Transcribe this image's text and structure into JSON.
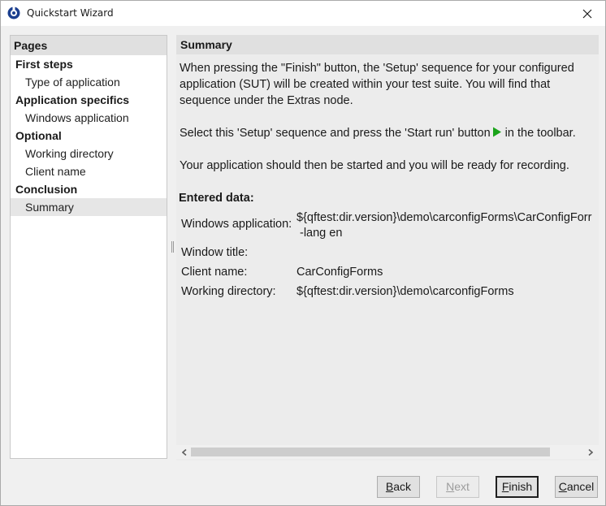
{
  "window": {
    "title": "Quickstart Wizard",
    "icon": "qftest-logo-icon",
    "close_icon": "close-icon"
  },
  "pages": {
    "header": "Pages",
    "items": [
      {
        "label": "First steps",
        "kind": "group",
        "selected": false
      },
      {
        "label": "Type of application",
        "kind": "sub",
        "selected": false
      },
      {
        "label": "Application specifics",
        "kind": "group",
        "selected": false
      },
      {
        "label": "Windows application",
        "kind": "sub",
        "selected": false
      },
      {
        "label": "Optional",
        "kind": "group",
        "selected": false
      },
      {
        "label": "Working directory",
        "kind": "sub",
        "selected": false
      },
      {
        "label": "Client name",
        "kind": "sub",
        "selected": false
      },
      {
        "label": "Conclusion",
        "kind": "group",
        "selected": false
      },
      {
        "label": "Summary",
        "kind": "sub",
        "selected": true
      }
    ]
  },
  "summary": {
    "header": "Summary",
    "paragraph1": [
      "When pressing the \"Finish\" button, the 'Setup' sequence for your configured",
      "application (SUT) will be created within your test suite. You will find that",
      "sequence under the Extras node."
    ],
    "paragraph2_before": "Select this 'Setup' sequence and press the 'Start run' button",
    "paragraph2_icon": "play-icon",
    "paragraph2_after": "in the toolbar.",
    "paragraph3": "Your application should then be started and you will be ready for recording.",
    "entered_title": "Entered data:",
    "entered_data": [
      {
        "label": "Windows application:",
        "value": "${qftest:dir.version}\\demo\\carconfigForms\\CarConfigForr",
        "value2": "-lang en"
      },
      {
        "label": "Window title:",
        "value": ""
      },
      {
        "label": "Client name:",
        "value": "CarConfigForms"
      },
      {
        "label": "Working directory:",
        "value": "${qftest:dir.version}\\demo\\carconfigForms"
      }
    ]
  },
  "buttons": {
    "back": {
      "mnemonic": "B",
      "rest": "ack",
      "enabled": true
    },
    "next": {
      "mnemonic": "N",
      "rest": "ext",
      "enabled": false
    },
    "finish": {
      "mnemonic": "F",
      "rest": "inish",
      "enabled": true,
      "default": true
    },
    "cancel": {
      "mnemonic": "C",
      "rest": "ancel",
      "enabled": true
    }
  },
  "colors": {
    "accent_play": "#1aa31a",
    "logo": "#1b3f8f"
  }
}
